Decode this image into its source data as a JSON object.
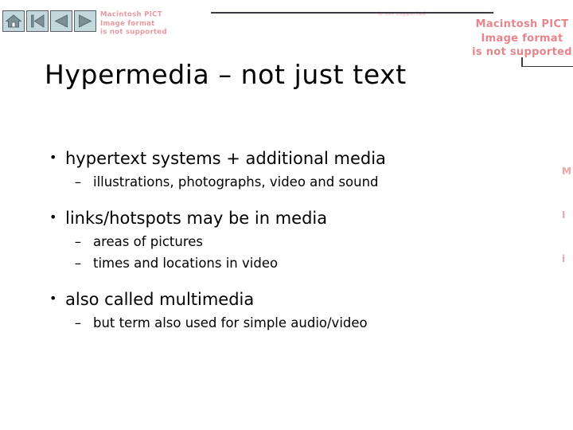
{
  "slide": {
    "title": "Hypermedia – not just text",
    "background_color": "#ffffff",
    "text_color": "#000000"
  },
  "navigation": {
    "buttons": [
      {
        "icon": "home-icon",
        "label": "Home"
      },
      {
        "icon": "skip-to-start-icon",
        "label": "First"
      },
      {
        "icon": "previous-icon",
        "label": "Back"
      },
      {
        "icon": "next-icon",
        "label": "Forward"
      }
    ],
    "button_fill": "#c3d8dc",
    "button_border": "#5a5f63",
    "glyph_fill": "#7b8f94"
  },
  "placeholders": {
    "accent_color": "#e8848c",
    "top_right": {
      "line1": "Macintosh PICT",
      "line2": "Image format",
      "line3": "is not supported"
    },
    "top_left": {
      "line1": "Macintosh PICT",
      "line2": "Image format",
      "line3": "is not supported"
    },
    "top_middle": {
      "line1": "is not supported"
    },
    "right_edge": {
      "line1": "M",
      "line2": "I",
      "line3": "i"
    }
  },
  "content": {
    "bullets": [
      {
        "text": "hypertext systems + additional media",
        "marker": "•",
        "sub_marker": "–",
        "sub": [
          "illustrations, photographs, video and sound"
        ]
      },
      {
        "text": "links/hotspots may be in media",
        "marker": "•",
        "sub_marker": "–",
        "sub": [
          "areas of pictures",
          "times and locations in video"
        ]
      },
      {
        "text": "also called multimedia",
        "marker": "•",
        "sub_marker": "–",
        "sub": [
          "but term also used for simple audio/video"
        ]
      }
    ]
  }
}
